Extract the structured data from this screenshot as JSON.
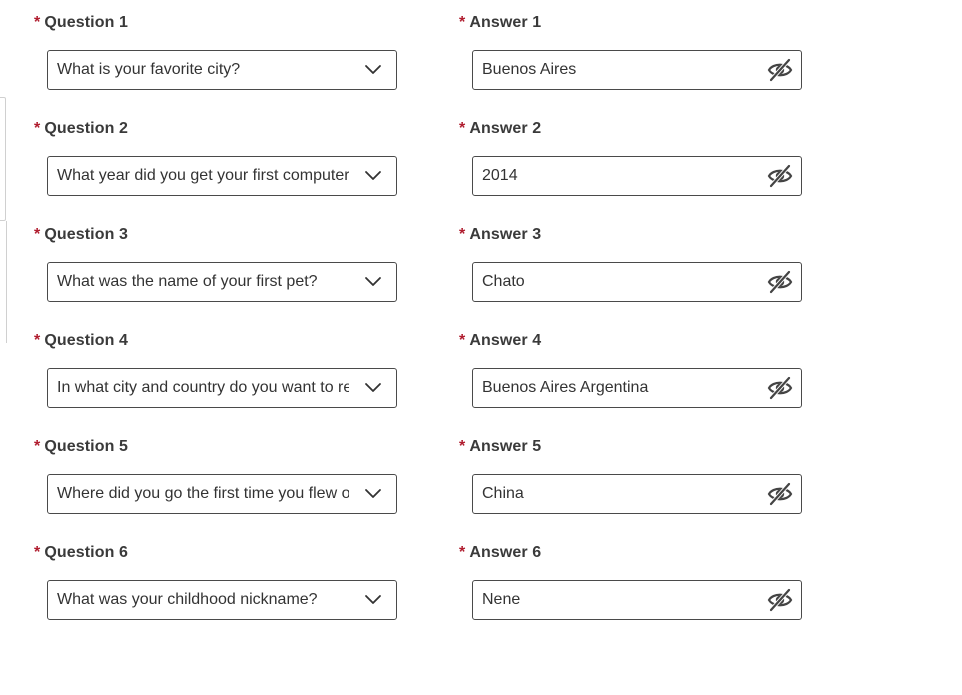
{
  "form": {
    "required_mark": "*",
    "rows": [
      {
        "question_label": "Question 1",
        "question_value": "What is your favorite city?",
        "answer_label": "Answer 1",
        "answer_value": "Buenos Aires"
      },
      {
        "question_label": "Question 2",
        "question_value": "What year did you get your first computer?",
        "answer_label": "Answer 2",
        "answer_value": "2014"
      },
      {
        "question_label": "Question 3",
        "question_value": "What was the name of your first pet?",
        "answer_label": "Answer 3",
        "answer_value": "Chato"
      },
      {
        "question_label": "Question 4",
        "question_value": "In what city and country do you want to retire?",
        "answer_label": "Answer 4",
        "answer_value": "Buenos Aires Argentina"
      },
      {
        "question_label": "Question 5",
        "question_value": "Where did you go the first time you flew on a plane?",
        "answer_label": "Answer 5",
        "answer_value": "China"
      },
      {
        "question_label": "Question 6",
        "question_value": "What was your childhood nickname?",
        "answer_label": "Answer 6",
        "answer_value": "Nene"
      }
    ],
    "icons": {
      "dropdown": "chevron-down-icon",
      "visibility": "eye-slash-icon"
    },
    "colors": {
      "required": "#b01c2e",
      "border": "#4a4a4a",
      "label": "#3a3a3a"
    }
  }
}
